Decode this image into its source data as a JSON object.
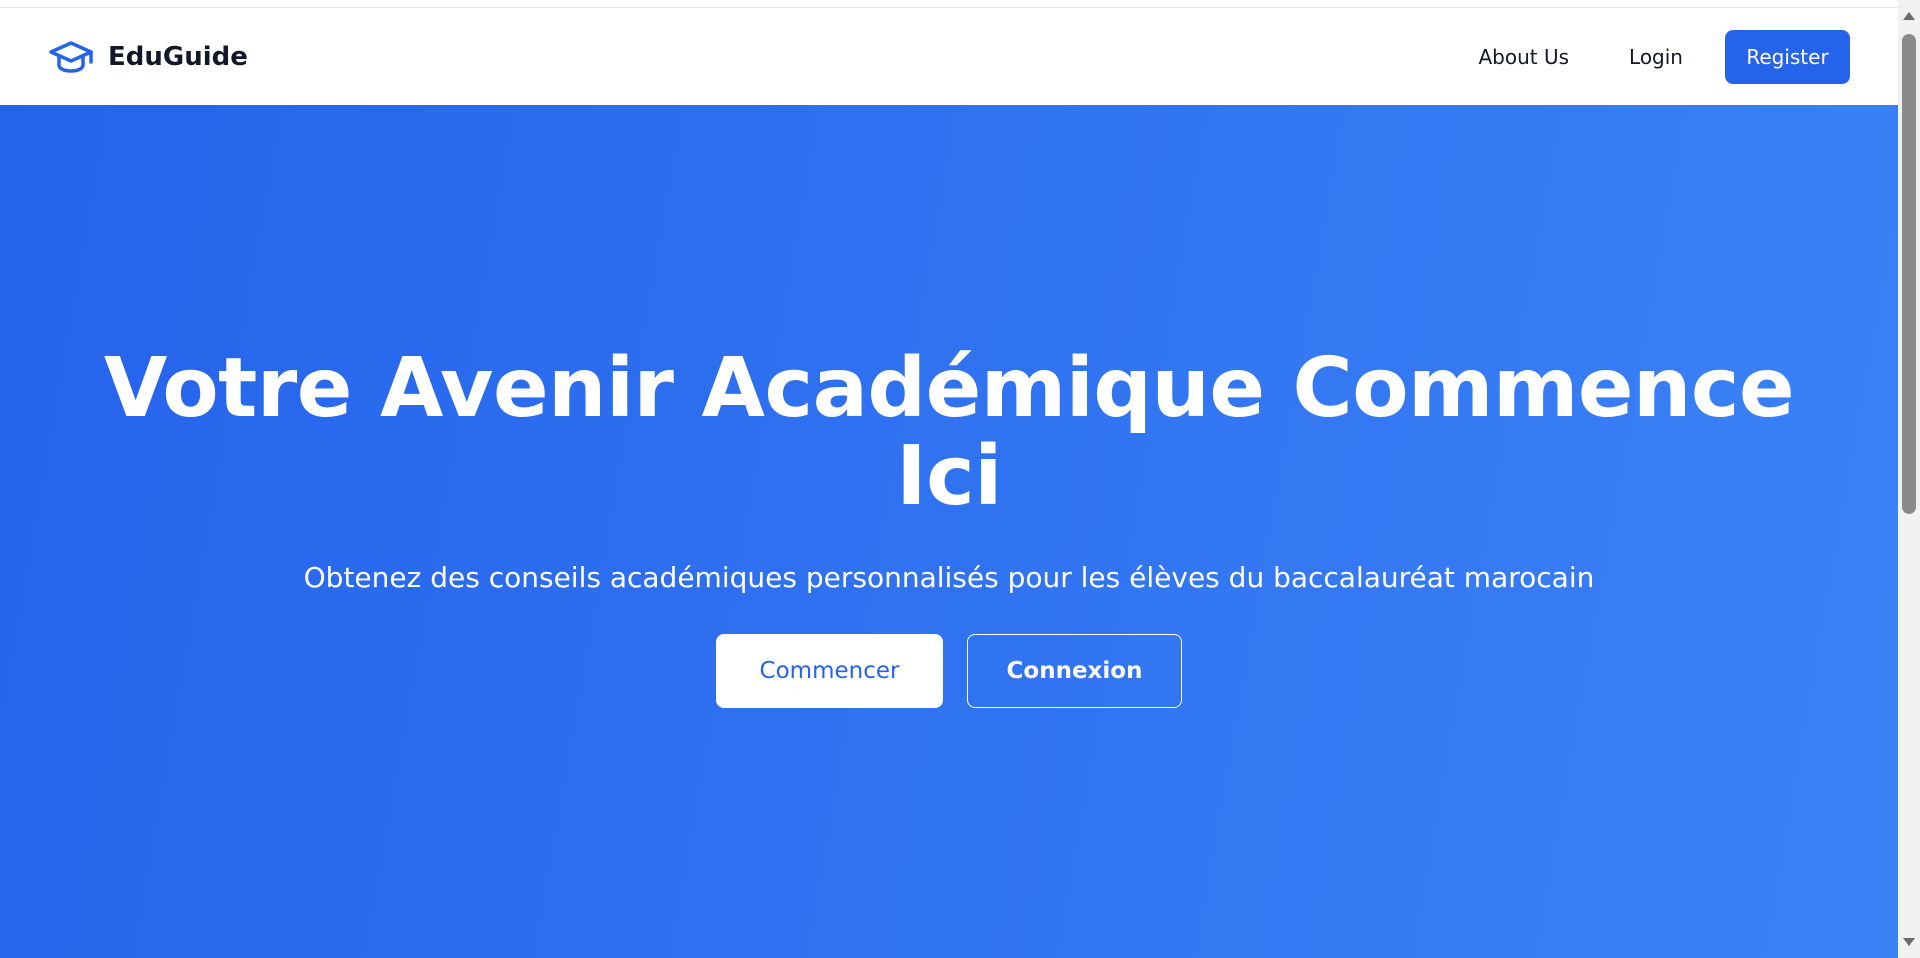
{
  "navbar": {
    "brand_name": "EduGuide",
    "brand_icon": "graduation-cap-icon",
    "links": {
      "about": "About Us",
      "login": "Login"
    },
    "register_label": "Register"
  },
  "hero": {
    "title": "Votre Avenir Académique Commence Ici",
    "subtitle": "Obtenez des conseils académiques personnalisés pour les élèves du baccalauréat marocain",
    "primary_button": "Commencer",
    "secondary_button": "Connexion"
  },
  "colors": {
    "brand_blue": "#2563eb",
    "hero_gradient_start": "#2563eb",
    "hero_gradient_end": "#3b82f6",
    "text_dark": "#111827",
    "white": "#ffffff"
  }
}
